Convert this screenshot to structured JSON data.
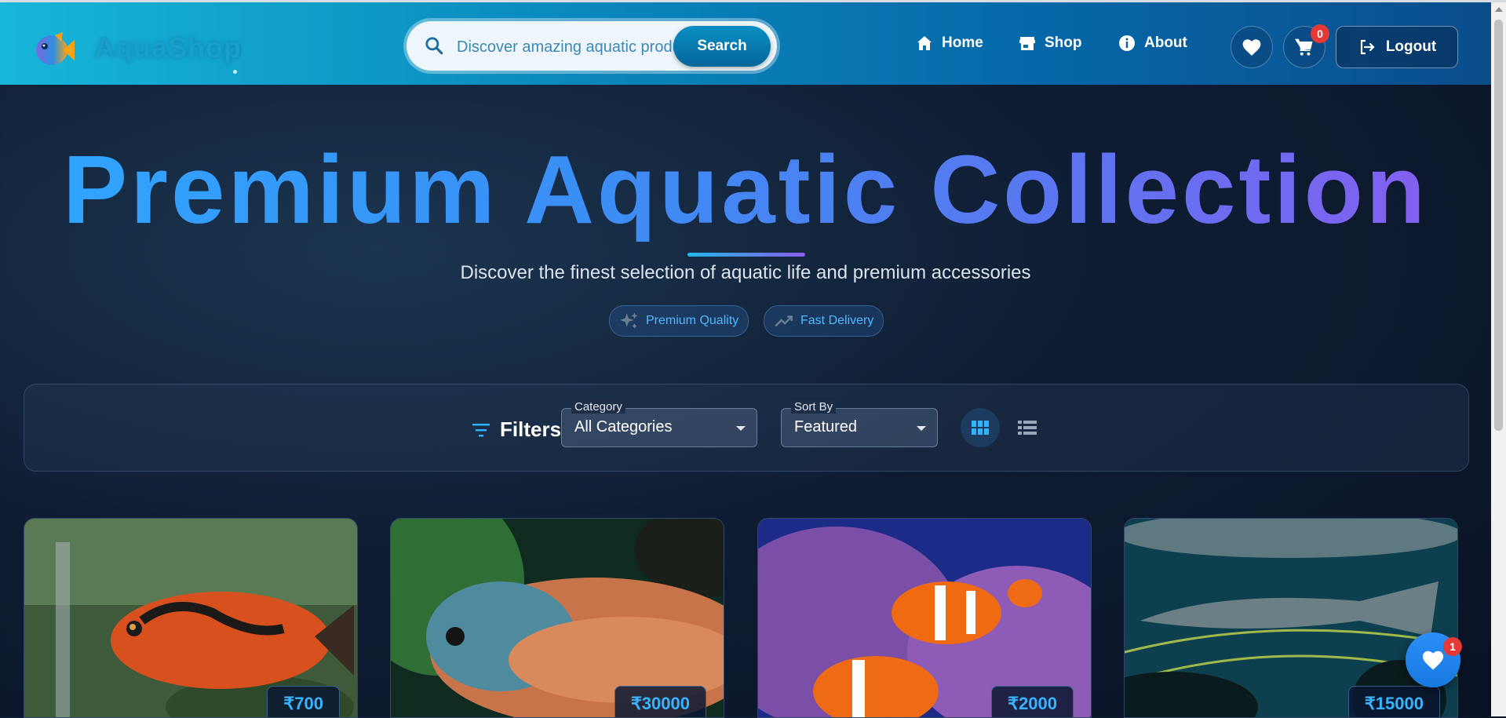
{
  "brand": {
    "name": "AquaShop"
  },
  "search": {
    "placeholder": "Discover amazing aquatic products...",
    "button_label": "Search"
  },
  "nav": {
    "home": "Home",
    "shop": "Shop",
    "about": "About",
    "logout": "Logout",
    "cart_count": "0"
  },
  "hero": {
    "title": "Premium Aquatic Collection",
    "subtitle": "Discover the finest selection of aquatic life and premium accessories",
    "badges": [
      "Premium Quality",
      "Fast Delivery"
    ]
  },
  "filters": {
    "label": "Filters",
    "category_label": "Category",
    "category_value": "All Categories",
    "sort_label": "Sort By",
    "sort_value": "Featured"
  },
  "products": [
    {
      "price": "₹700"
    },
    {
      "price": "₹30000"
    },
    {
      "price": "₹2000"
    },
    {
      "price": "₹15000"
    }
  ],
  "favorites": {
    "count": "1"
  },
  "colors": {
    "accent": "#38b4ff",
    "navbar_start": "#18b6d9",
    "navbar_end": "#0a4d8c",
    "badge": "#e53935"
  }
}
